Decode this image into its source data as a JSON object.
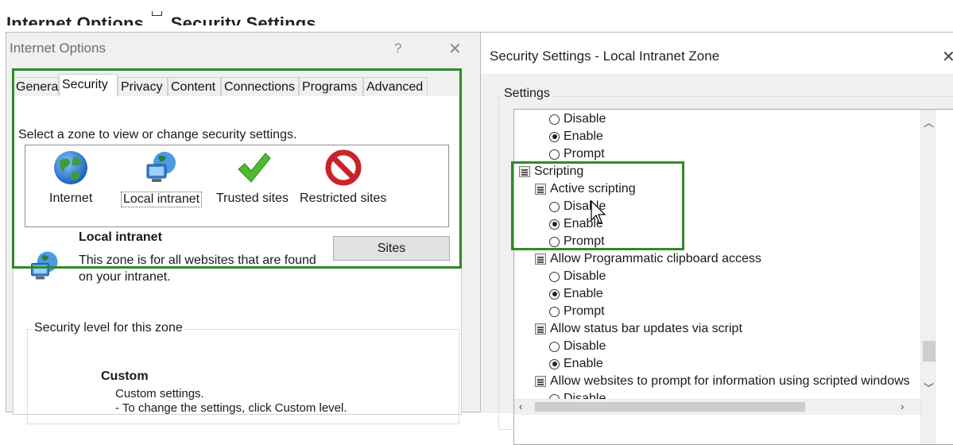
{
  "page": {
    "heading_part1": "Internet Options",
    "heading_qmark": "?",
    "heading_part2": "Security Settings"
  },
  "internet_options": {
    "title": "Internet Options",
    "help_label": "?",
    "close_label": "✕",
    "tabs": [
      {
        "label": "General"
      },
      {
        "label": "Security"
      },
      {
        "label": "Privacy"
      },
      {
        "label": "Content"
      },
      {
        "label": "Connections"
      },
      {
        "label": "Programs"
      },
      {
        "label": "Advanced"
      }
    ],
    "active_tab": "Security",
    "zone_prompt": "Select a zone to view or change security settings.",
    "zones": [
      {
        "label": "Internet",
        "icon": "globe-icon"
      },
      {
        "label": "Local intranet",
        "icon": "intranet-icon"
      },
      {
        "label": "Trusted sites",
        "icon": "checkmark-icon"
      },
      {
        "label": "Restricted sites",
        "icon": "prohibited-icon"
      }
    ],
    "selected_zone": "Local intranet",
    "zone_info": {
      "name": "Local intranet",
      "description": "This zone is for all websites that are found on your intranet.",
      "sites_button": "Sites"
    },
    "security_level": {
      "legend": "Security level for this zone",
      "level_name": "Custom",
      "line1": "Custom settings.",
      "line2": "- To change the settings, click Custom level."
    },
    "highlight_color": "#2f8a2a"
  },
  "security_settings": {
    "title": "Security Settings - Local Intranet Zone",
    "close_label": "✕",
    "settings_legend": "Settings",
    "tree": [
      {
        "type": "radio",
        "label": "Disable",
        "checked": false,
        "indent": 1
      },
      {
        "type": "radio",
        "label": "Enable",
        "checked": true,
        "indent": 1
      },
      {
        "type": "radio",
        "label": "Prompt",
        "checked": false,
        "indent": 1
      },
      {
        "type": "category",
        "label": "Scripting",
        "indent": 0
      },
      {
        "type": "setting",
        "label": "Active scripting",
        "indent": 1
      },
      {
        "type": "radio",
        "label": "Disable",
        "checked": false,
        "indent": 1
      },
      {
        "type": "radio",
        "label": "Enable",
        "checked": true,
        "indent": 1
      },
      {
        "type": "radio",
        "label": "Prompt",
        "checked": false,
        "indent": 1
      },
      {
        "type": "setting",
        "label": "Allow Programmatic clipboard access",
        "indent": 1
      },
      {
        "type": "radio",
        "label": "Disable",
        "checked": false,
        "indent": 1
      },
      {
        "type": "radio",
        "label": "Enable",
        "checked": true,
        "indent": 1
      },
      {
        "type": "radio",
        "label": "Prompt",
        "checked": false,
        "indent": 1
      },
      {
        "type": "setting",
        "label": "Allow status bar updates via script",
        "indent": 1
      },
      {
        "type": "radio",
        "label": "Disable",
        "checked": false,
        "indent": 1
      },
      {
        "type": "radio",
        "label": "Enable",
        "checked": true,
        "indent": 1
      },
      {
        "type": "setting",
        "label": "Allow websites to prompt for information using scripted windows",
        "indent": 1
      },
      {
        "type": "radio",
        "label": "Disable",
        "checked": false,
        "indent": 1
      }
    ]
  }
}
